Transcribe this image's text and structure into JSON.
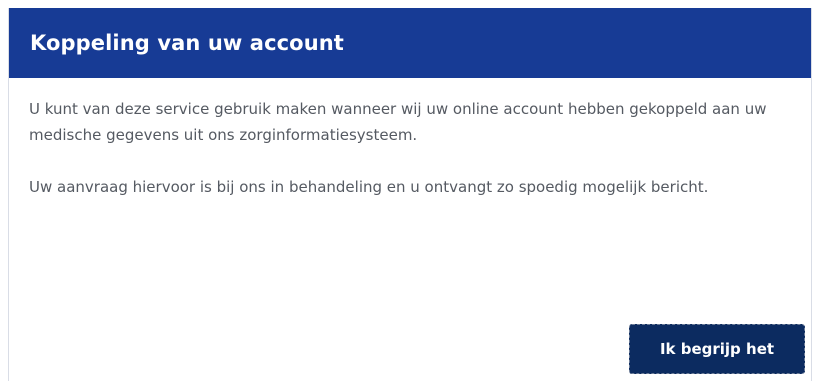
{
  "dialog": {
    "title": "Koppeling van uw account",
    "paragraphs": [
      "U kunt van deze service gebruik maken wanneer wij uw online account hebben gekoppeld aan uw medische gegevens uit ons zorginformatiesysteem.",
      "Uw aanvraag hiervoor is bij ons in behandeling en u ontvangt zo spoedig mogelijk bericht."
    ],
    "button_label": "Ik begrijp het"
  },
  "colors": {
    "header_background": "#173b95",
    "button_background": "#0c2b60",
    "body_text": "#555a62"
  }
}
